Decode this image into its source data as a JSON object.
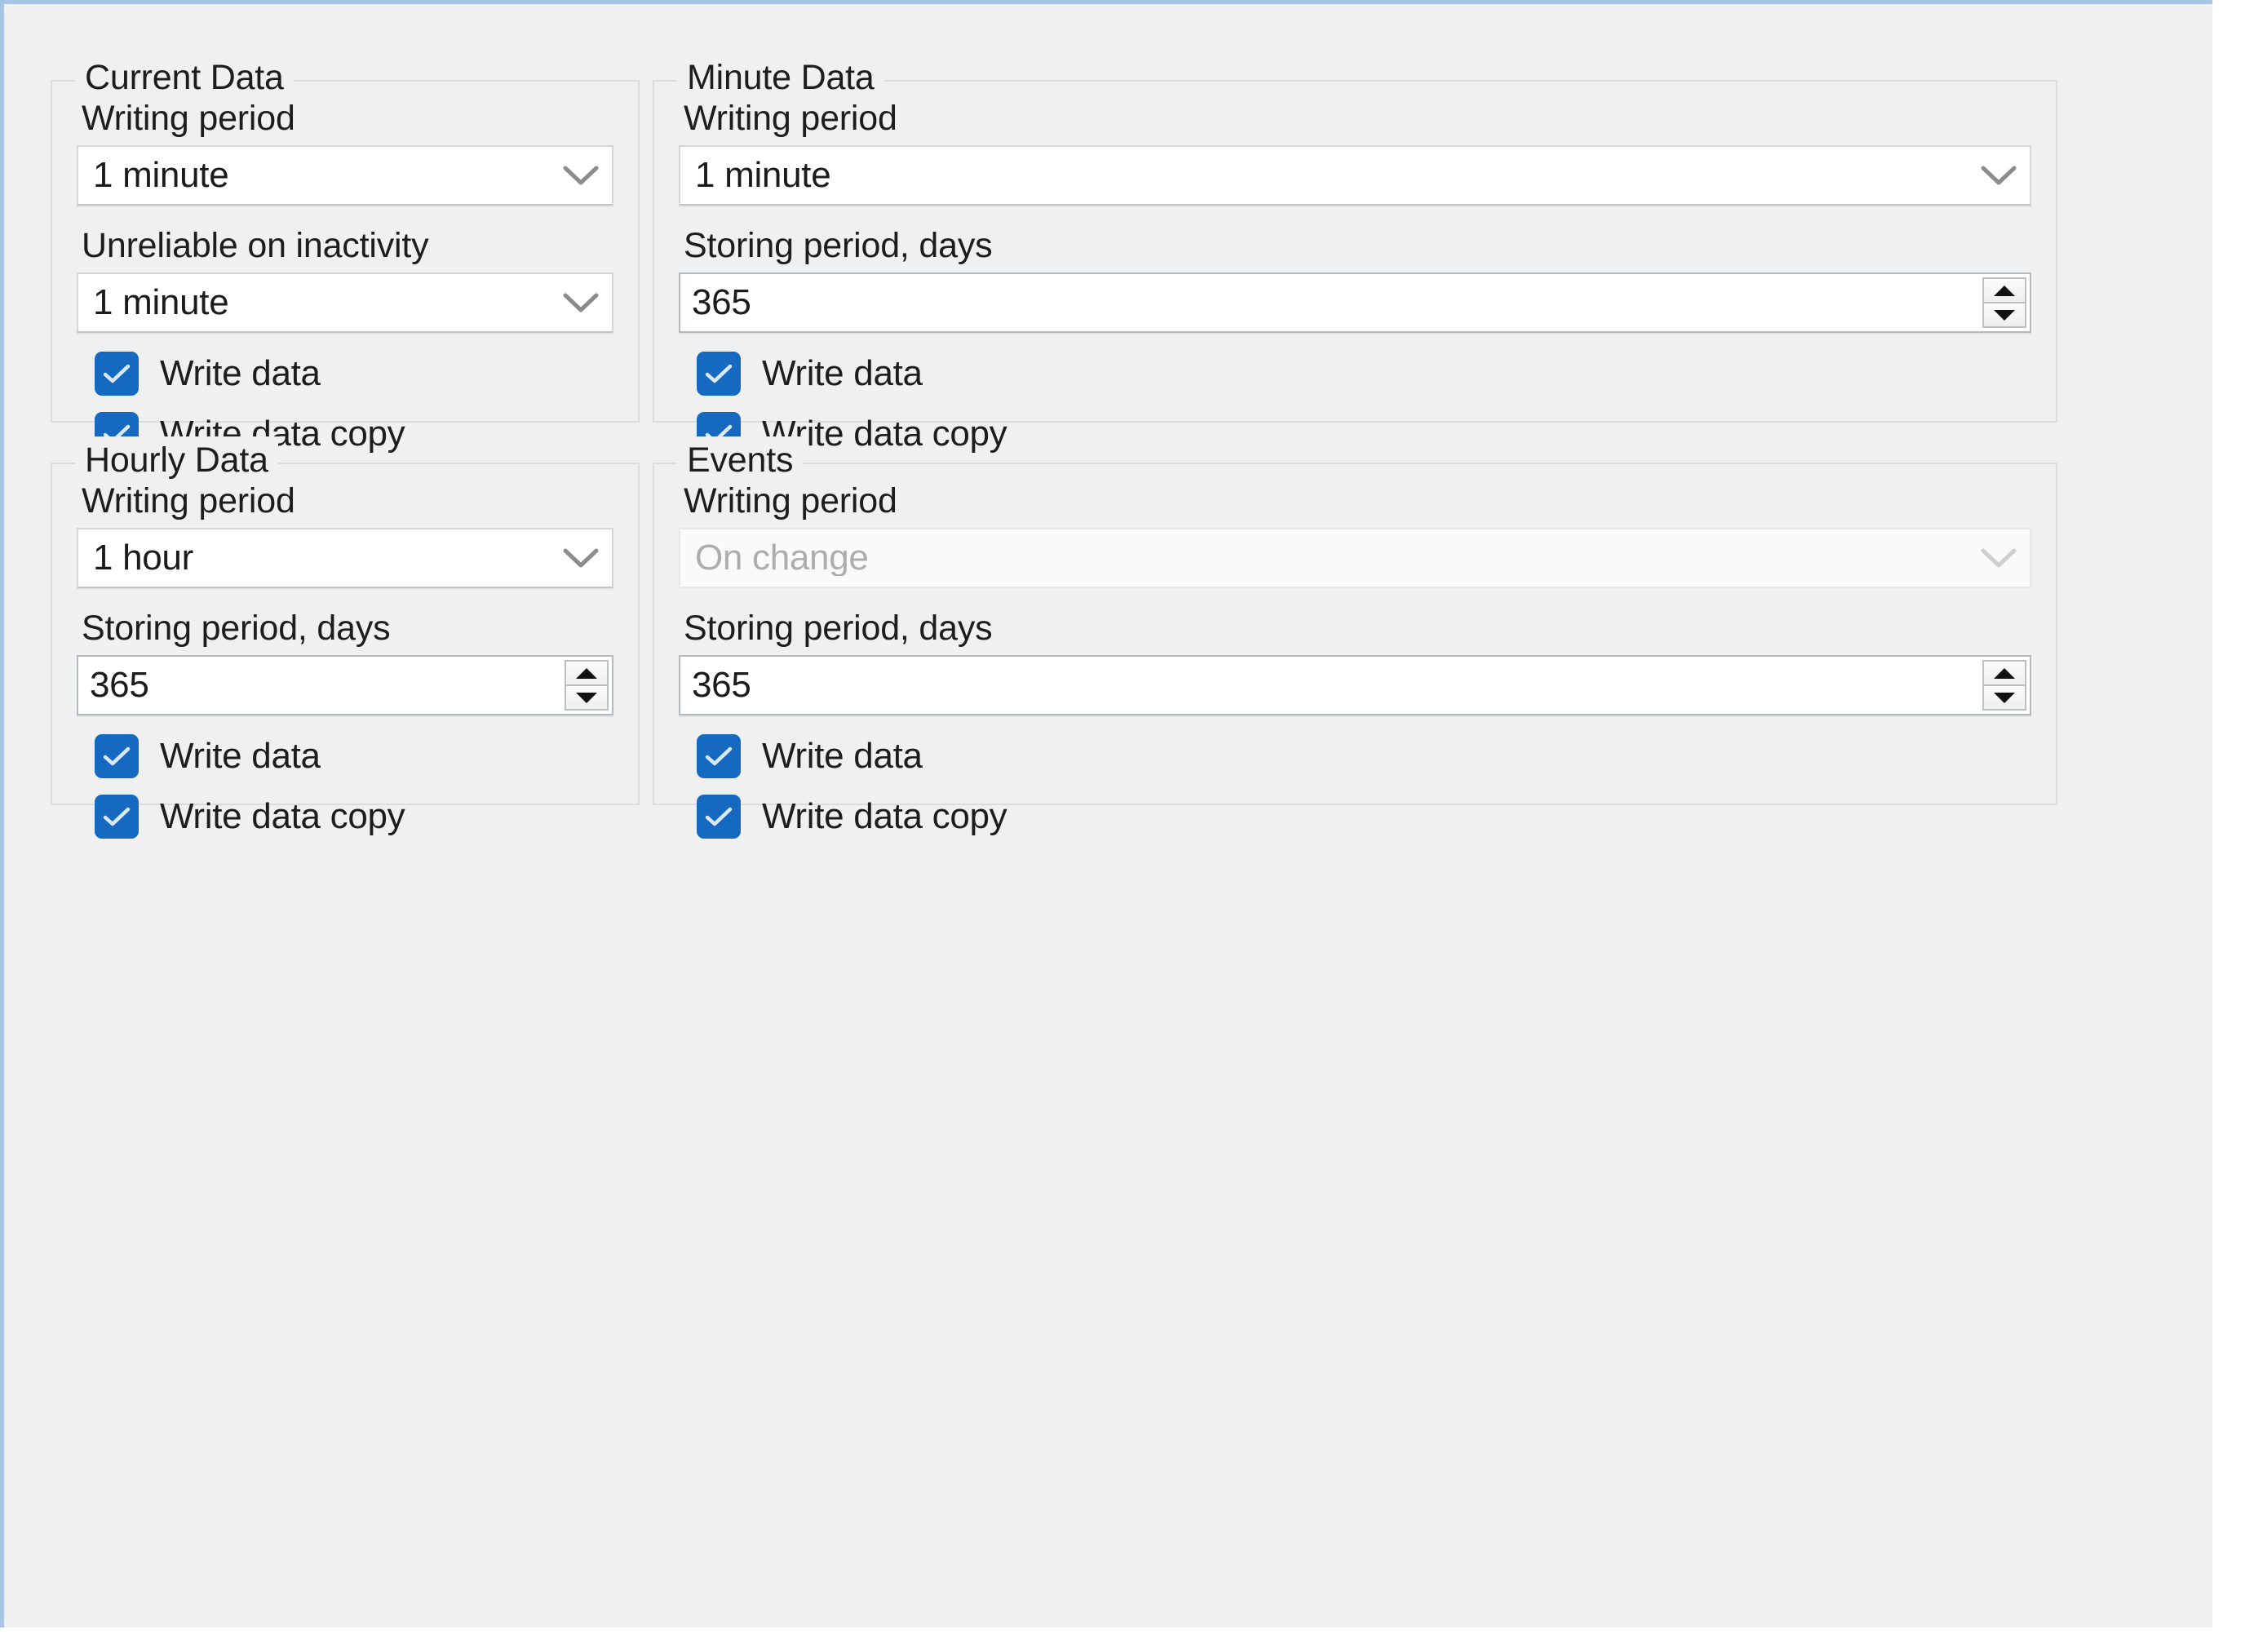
{
  "colors": {
    "window_border": "#a8c4e4",
    "background": "#f0f0f0",
    "group_border": "#dcdcdc",
    "checkbox_accent": "#1669c1",
    "text": "#1d1d1d",
    "disabled_text": "#adadad"
  },
  "groups": [
    {
      "id": "current",
      "title": "Current Data",
      "fields": [
        {
          "kind": "combo",
          "label": "Writing period",
          "value": "1 minute",
          "disabled": false
        },
        {
          "kind": "combo",
          "label": "Unreliable on inactivity",
          "value": "1 minute",
          "disabled": false
        }
      ],
      "checkboxes": [
        {
          "label": "Write data",
          "checked": true
        },
        {
          "label": "Write data copy",
          "checked": true
        }
      ]
    },
    {
      "id": "minute",
      "title": "Minute Data",
      "fields": [
        {
          "kind": "combo",
          "label": "Writing period",
          "value": "1 minute",
          "disabled": false
        },
        {
          "kind": "spin",
          "label": "Storing period, days",
          "value": "365",
          "disabled": false
        }
      ],
      "checkboxes": [
        {
          "label": "Write data",
          "checked": true
        },
        {
          "label": "Write data copy",
          "checked": true
        }
      ]
    },
    {
      "id": "hourly",
      "title": "Hourly Data",
      "fields": [
        {
          "kind": "combo",
          "label": "Writing period",
          "value": "1 hour",
          "disabled": false
        },
        {
          "kind": "spin",
          "label": "Storing period, days",
          "value": "365",
          "disabled": false
        }
      ],
      "checkboxes": [
        {
          "label": "Write data",
          "checked": true
        },
        {
          "label": "Write data copy",
          "checked": true
        }
      ]
    },
    {
      "id": "events",
      "title": "Events",
      "fields": [
        {
          "kind": "combo",
          "label": "Writing period",
          "value": "On change",
          "disabled": true
        },
        {
          "kind": "spin",
          "label": "Storing period, days",
          "value": "365",
          "disabled": false
        }
      ],
      "checkboxes": [
        {
          "label": "Write data",
          "checked": true
        },
        {
          "label": "Write data copy",
          "checked": true
        }
      ]
    }
  ],
  "icons": {
    "chevron": "chevron-down-icon",
    "check": "check-icon",
    "spin_up": "spinner-up-icon",
    "spin_down": "spinner-down-icon"
  }
}
